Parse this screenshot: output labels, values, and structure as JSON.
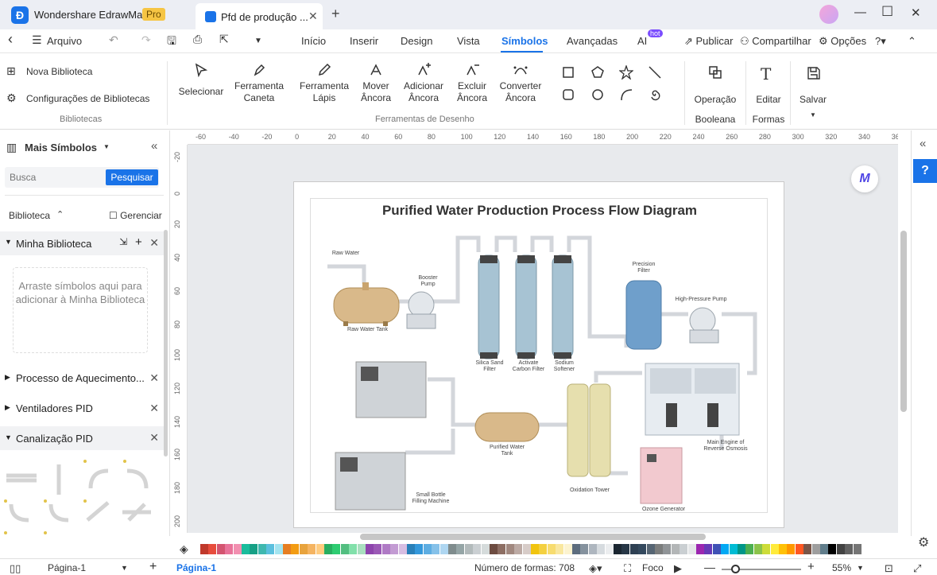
{
  "titlebar": {
    "app_name": "Wondershare EdrawMax",
    "pro_badge": "Pro",
    "doc_tab": "Pfd de produção ...",
    "close_tab": "✕",
    "new_tab": "+",
    "minimize": "—",
    "maximize": "☐",
    "close": "✕"
  },
  "menubar": {
    "back": "‹",
    "file_menu": "Arquivo",
    "items": [
      "Início",
      "Inserir",
      "Design",
      "Vista",
      "Símbolos",
      "Avançadas",
      "AI"
    ],
    "active": "Símbolos",
    "hot_badge": "hot",
    "publish": "Publicar",
    "share": "Compartilhar",
    "options": "Opções"
  },
  "ribbon": {
    "library": {
      "new_library": "Nova Biblioteca",
      "library_settings": "Configurações de Bibliotecas",
      "group_title": "Bibliotecas"
    },
    "tools": {
      "select": "Selecionar",
      "pen": [
        "Ferramenta",
        "Caneta"
      ],
      "pencil": [
        "Ferramenta",
        "Lápis"
      ],
      "move_anchor": [
        "Mover",
        "Âncora"
      ],
      "add_anchor": [
        "Adicionar",
        "Âncora"
      ],
      "delete_anchor": [
        "Excluir",
        "Âncora"
      ],
      "convert_anchor": [
        "Converter",
        "Âncora"
      ],
      "group_title": "Ferramentas de Desenho"
    },
    "boolean": [
      "Operação",
      "Booleana"
    ],
    "edit_shapes": [
      "Editar",
      "Formas"
    ],
    "save": "Salvar"
  },
  "leftpanel": {
    "title": "Mais Símbolos",
    "search_placeholder": "Busca",
    "search_button": "Pesquisar",
    "library_label": "Biblioteca",
    "manage": "Gerenciar",
    "my_library": "Minha Biblioteca",
    "drop_hint": "Arraste símbolos aqui para adicionar à Minha Biblioteca",
    "sections": [
      "Processo de Aquecimento...",
      "Ventiladores PID",
      "Canalização PID"
    ]
  },
  "ruler": {
    "h_ticks": [
      "-60",
      "-40",
      "-20",
      "0",
      "20",
      "40",
      "60",
      "80",
      "100",
      "120",
      "140",
      "160",
      "180",
      "200",
      "220",
      "240",
      "260",
      "280",
      "300",
      "320",
      "340",
      "36"
    ],
    "v_ticks": [
      "-20",
      "0",
      "20",
      "40",
      "60",
      "80",
      "100",
      "120",
      "140",
      "160",
      "180",
      "200"
    ]
  },
  "diagram": {
    "title": "Purified Water Production Process Flow Diagram",
    "labels": {
      "raw_water": "Raw Water",
      "raw_water_tank": "Raw Water Tank",
      "booster_pump": "Booster\nPump",
      "silica_sand_filter": "Silica Sand\nFilter",
      "activate_carbon_filter": "Activate\nCarbon Filter",
      "sodium_softener": "Sodium\nSoftener",
      "precision_filter": "Precision\nFilter",
      "high_pressure_pump": "High-Pressure Pump",
      "purified_water_tank": "Purified Water\nTank",
      "oxidation_tower": "Oxidation Tower",
      "main_engine_ro": "Main Engine of\nReverse Osmosis",
      "small_bottle_filling": "Small Bottle\nFilling Machine",
      "ozone_generator": "Ozone Generator"
    }
  },
  "colors": {
    "accent": "#1a73e8",
    "swatches": [
      "#c0392b",
      "#e74c3c",
      "#d35470",
      "#e8739a",
      "#f28fb0",
      "#1abc9c",
      "#16a085",
      "#3fb8af",
      "#5bc0de",
      "#a3e4f0",
      "#e67e22",
      "#f39c12",
      "#e8a33d",
      "#f5b461",
      "#ffcc80",
      "#27ae60",
      "#2ecc71",
      "#52be80",
      "#82e0aa",
      "#a9dfbf",
      "#8e44ad",
      "#9b59b6",
      "#af7ac5",
      "#c39bd3",
      "#d7bde2",
      "#2980b9",
      "#3498db",
      "#5dade2",
      "#85c1e9",
      "#aed6f1",
      "#7f8c8d",
      "#95a5a6",
      "#b2babb",
      "#cacfd2",
      "#d5dbdb",
      "#6d4c41",
      "#8d6e63",
      "#a1887f",
      "#bcaaa4",
      "#d7ccc8",
      "#f1c40f",
      "#f4d03f",
      "#f7dc6f",
      "#f9e79f",
      "#fcf3cf",
      "#5d6d7e",
      "#85929e",
      "#aeb6bf",
      "#d6dbdf",
      "#ebedef",
      "#1b2631",
      "#273746",
      "#2e4053",
      "#34495e",
      "#566573",
      "#7b7d7d",
      "#909497",
      "#b3b6b7",
      "#cacfd2",
      "#e5e7e9",
      "#9c27b0",
      "#673ab7",
      "#3f51b5",
      "#03a9f4",
      "#00bcd4",
      "#009688",
      "#4caf50",
      "#8bc34a",
      "#cddc39",
      "#ffeb3b",
      "#ffc107",
      "#ff9800",
      "#ff5722",
      "#795548",
      "#9e9e9e",
      "#607d8b",
      "#000000",
      "#424242",
      "#616161",
      "#757575"
    ]
  },
  "statusbar": {
    "page_selector": "Página-1",
    "add_page": "+",
    "active_page": "Página-1",
    "shape_count": "Número de formas: 708",
    "focus": "Foco",
    "zoom": "55%"
  }
}
